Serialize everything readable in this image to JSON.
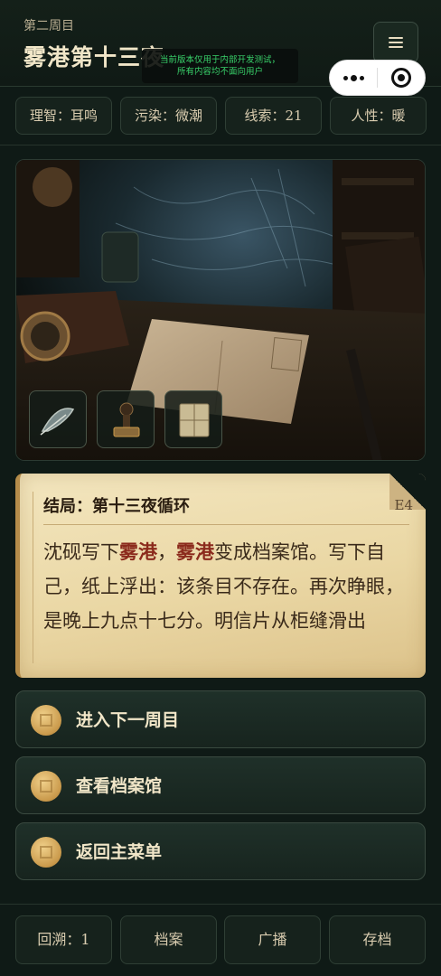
{
  "header": {
    "chapter": "第二周目",
    "title": "雾港第十三夜",
    "dev_notice_line1": "当前版本仅用于内部开发测试，",
    "dev_notice_line2": "所有内容均不面向用户"
  },
  "stats": [
    {
      "label": "理智：耳鸣"
    },
    {
      "label": "污染：微潮"
    },
    {
      "label": "线索：21"
    },
    {
      "label": "人性：暖"
    }
  ],
  "scene": {
    "inventory": [
      "feather-icon",
      "stamp-icon",
      "envelope-icon"
    ]
  },
  "ending": {
    "title": "结局：第十三夜循环",
    "code": "E4",
    "body_part1": "沈砚写下",
    "highlight1": "雾港",
    "body_part2": "，",
    "highlight2": "雾港",
    "body_part3": "变成档案馆。写下自己，纸上浮出：该条目不存在。再次睁眼，是晚上九点十七分。明信片从柜缝滑出"
  },
  "actions": [
    {
      "label": "进入下一周目"
    },
    {
      "label": "查看档案馆"
    },
    {
      "label": "返回主菜单"
    }
  ],
  "bottom_bar": [
    {
      "label": "回溯：1"
    },
    {
      "label": "档案"
    },
    {
      "label": "广播"
    },
    {
      "label": "存档"
    }
  ],
  "colors": {
    "background": "#0f1a16",
    "gold": "#c9994b",
    "highlight": "#8b2a1c"
  }
}
